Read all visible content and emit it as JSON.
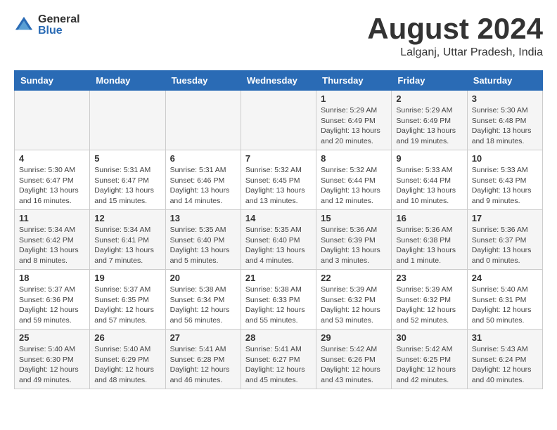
{
  "logo": {
    "general": "General",
    "blue": "Blue"
  },
  "header": {
    "month": "August 2024",
    "location": "Lalganj, Uttar Pradesh, India"
  },
  "weekdays": [
    "Sunday",
    "Monday",
    "Tuesday",
    "Wednesday",
    "Thursday",
    "Friday",
    "Saturday"
  ],
  "weeks": [
    [
      {
        "day": "",
        "info": ""
      },
      {
        "day": "",
        "info": ""
      },
      {
        "day": "",
        "info": ""
      },
      {
        "day": "",
        "info": ""
      },
      {
        "day": "1",
        "info": "Sunrise: 5:29 AM\nSunset: 6:49 PM\nDaylight: 13 hours\nand 20 minutes."
      },
      {
        "day": "2",
        "info": "Sunrise: 5:29 AM\nSunset: 6:49 PM\nDaylight: 13 hours\nand 19 minutes."
      },
      {
        "day": "3",
        "info": "Sunrise: 5:30 AM\nSunset: 6:48 PM\nDaylight: 13 hours\nand 18 minutes."
      }
    ],
    [
      {
        "day": "4",
        "info": "Sunrise: 5:30 AM\nSunset: 6:47 PM\nDaylight: 13 hours\nand 16 minutes."
      },
      {
        "day": "5",
        "info": "Sunrise: 5:31 AM\nSunset: 6:47 PM\nDaylight: 13 hours\nand 15 minutes."
      },
      {
        "day": "6",
        "info": "Sunrise: 5:31 AM\nSunset: 6:46 PM\nDaylight: 13 hours\nand 14 minutes."
      },
      {
        "day": "7",
        "info": "Sunrise: 5:32 AM\nSunset: 6:45 PM\nDaylight: 13 hours\nand 13 minutes."
      },
      {
        "day": "8",
        "info": "Sunrise: 5:32 AM\nSunset: 6:44 PM\nDaylight: 13 hours\nand 12 minutes."
      },
      {
        "day": "9",
        "info": "Sunrise: 5:33 AM\nSunset: 6:44 PM\nDaylight: 13 hours\nand 10 minutes."
      },
      {
        "day": "10",
        "info": "Sunrise: 5:33 AM\nSunset: 6:43 PM\nDaylight: 13 hours\nand 9 minutes."
      }
    ],
    [
      {
        "day": "11",
        "info": "Sunrise: 5:34 AM\nSunset: 6:42 PM\nDaylight: 13 hours\nand 8 minutes."
      },
      {
        "day": "12",
        "info": "Sunrise: 5:34 AM\nSunset: 6:41 PM\nDaylight: 13 hours\nand 7 minutes."
      },
      {
        "day": "13",
        "info": "Sunrise: 5:35 AM\nSunset: 6:40 PM\nDaylight: 13 hours\nand 5 minutes."
      },
      {
        "day": "14",
        "info": "Sunrise: 5:35 AM\nSunset: 6:40 PM\nDaylight: 13 hours\nand 4 minutes."
      },
      {
        "day": "15",
        "info": "Sunrise: 5:36 AM\nSunset: 6:39 PM\nDaylight: 13 hours\nand 3 minutes."
      },
      {
        "day": "16",
        "info": "Sunrise: 5:36 AM\nSunset: 6:38 PM\nDaylight: 13 hours\nand 1 minute."
      },
      {
        "day": "17",
        "info": "Sunrise: 5:36 AM\nSunset: 6:37 PM\nDaylight: 13 hours\nand 0 minutes."
      }
    ],
    [
      {
        "day": "18",
        "info": "Sunrise: 5:37 AM\nSunset: 6:36 PM\nDaylight: 12 hours\nand 59 minutes."
      },
      {
        "day": "19",
        "info": "Sunrise: 5:37 AM\nSunset: 6:35 PM\nDaylight: 12 hours\nand 57 minutes."
      },
      {
        "day": "20",
        "info": "Sunrise: 5:38 AM\nSunset: 6:34 PM\nDaylight: 12 hours\nand 56 minutes."
      },
      {
        "day": "21",
        "info": "Sunrise: 5:38 AM\nSunset: 6:33 PM\nDaylight: 12 hours\nand 55 minutes."
      },
      {
        "day": "22",
        "info": "Sunrise: 5:39 AM\nSunset: 6:32 PM\nDaylight: 12 hours\nand 53 minutes."
      },
      {
        "day": "23",
        "info": "Sunrise: 5:39 AM\nSunset: 6:32 PM\nDaylight: 12 hours\nand 52 minutes."
      },
      {
        "day": "24",
        "info": "Sunrise: 5:40 AM\nSunset: 6:31 PM\nDaylight: 12 hours\nand 50 minutes."
      }
    ],
    [
      {
        "day": "25",
        "info": "Sunrise: 5:40 AM\nSunset: 6:30 PM\nDaylight: 12 hours\nand 49 minutes."
      },
      {
        "day": "26",
        "info": "Sunrise: 5:40 AM\nSunset: 6:29 PM\nDaylight: 12 hours\nand 48 minutes."
      },
      {
        "day": "27",
        "info": "Sunrise: 5:41 AM\nSunset: 6:28 PM\nDaylight: 12 hours\nand 46 minutes."
      },
      {
        "day": "28",
        "info": "Sunrise: 5:41 AM\nSunset: 6:27 PM\nDaylight: 12 hours\nand 45 minutes."
      },
      {
        "day": "29",
        "info": "Sunrise: 5:42 AM\nSunset: 6:26 PM\nDaylight: 12 hours\nand 43 minutes."
      },
      {
        "day": "30",
        "info": "Sunrise: 5:42 AM\nSunset: 6:25 PM\nDaylight: 12 hours\nand 42 minutes."
      },
      {
        "day": "31",
        "info": "Sunrise: 5:43 AM\nSunset: 6:24 PM\nDaylight: 12 hours\nand 40 minutes."
      }
    ]
  ]
}
